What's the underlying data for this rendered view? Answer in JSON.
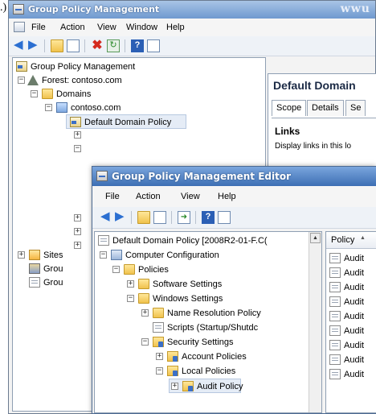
{
  "stray_text": ".)",
  "bg_window": {
    "title": "Group Policy Management",
    "titlebar_right_text": "wwu",
    "menu": [
      "File",
      "Action",
      "View",
      "Window",
      "Help"
    ],
    "tree": [
      {
        "label": "Group Policy Management"
      },
      {
        "label": "Forest: contoso.com"
      },
      {
        "label": "Domains"
      },
      {
        "label": "contoso.com"
      },
      {
        "label": "Default Domain Policy"
      },
      {
        "label": "Sites"
      },
      {
        "label": "Grou"
      },
      {
        "label": "Grou"
      }
    ],
    "right_pane": {
      "title": "Default Domain",
      "tabs": [
        "Scope",
        "Details",
        "Se"
      ],
      "links_heading": "Links",
      "links_text": "Display links in this lo"
    }
  },
  "editor_window": {
    "title": "Group Policy Management Editor",
    "menu": [
      "File",
      "Action",
      "View",
      "Help"
    ],
    "tree": [
      {
        "label": "Default Domain Policy [2008R2-01-F.C("
      },
      {
        "label": "Computer Configuration"
      },
      {
        "label": "Policies"
      },
      {
        "label": "Software Settings"
      },
      {
        "label": "Windows Settings"
      },
      {
        "label": "Name Resolution Policy"
      },
      {
        "label": "Scripts (Startup/Shutdc"
      },
      {
        "label": "Security Settings"
      },
      {
        "label": "Account Policies"
      },
      {
        "label": "Local Policies"
      },
      {
        "label": "Audit Policy"
      }
    ],
    "list_header": "Policy",
    "list_items": [
      "Audit",
      "Audit",
      "Audit",
      "Audit",
      "Audit",
      "Audit",
      "Audit",
      "Audit",
      "Audit"
    ]
  }
}
